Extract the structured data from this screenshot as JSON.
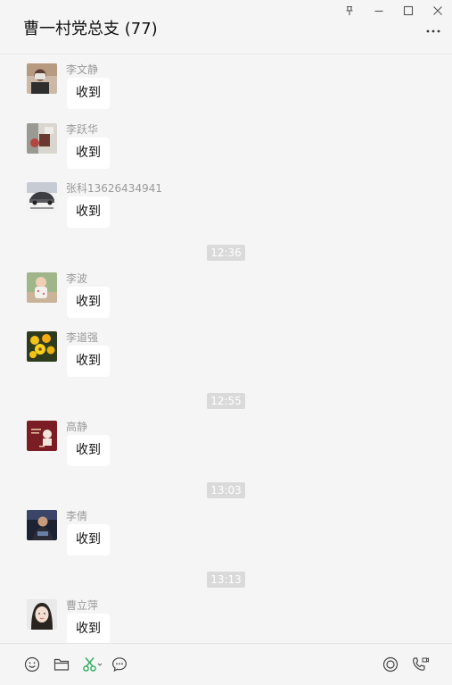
{
  "header": {
    "title": "曹一村党总支 (77)"
  },
  "messages": [
    {
      "sender": "李文静",
      "text": "收到"
    },
    {
      "sender": "李跃华",
      "text": "收到"
    },
    {
      "sender": "张科13626434941",
      "text": "收到"
    },
    {
      "sender": "李波",
      "text": "收到"
    },
    {
      "sender": "李道强",
      "text": "收到"
    },
    {
      "sender": "高静",
      "text": "收到"
    },
    {
      "sender": "李倩",
      "text": "收到"
    },
    {
      "sender": "曹立萍",
      "text": "收到"
    }
  ],
  "timestamps": [
    "12:36",
    "12:55",
    "13:03",
    "13:13"
  ],
  "colors": {
    "background": "#f5f5f5",
    "bubble": "#ffffff",
    "timestamp_bg": "#dadada",
    "scissors_accent": "#2bad5b"
  },
  "icons": {
    "window": [
      "pin-icon",
      "minimize-icon",
      "maximize-icon",
      "close-icon",
      "more-icon"
    ],
    "toolbar": [
      "emoji-icon",
      "folder-icon",
      "scissors-icon",
      "chat-history-icon",
      "live-icon",
      "call-icon"
    ]
  }
}
